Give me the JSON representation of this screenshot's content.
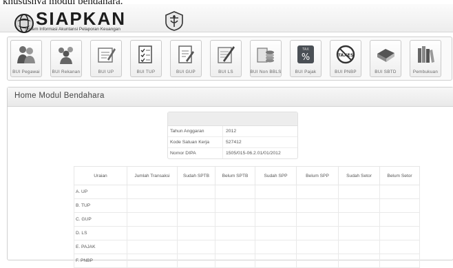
{
  "page_caption": "khususnya modul bendahara.",
  "app": {
    "title": "SIAPKAN",
    "subtitle": "Sistem Informasi Akuntansi Pelaporan Keuangan"
  },
  "toolbar": {
    "buttons": [
      {
        "label": "BUI Pegawai",
        "icon": "people-icon"
      },
      {
        "label": "BUI Rekanan",
        "icon": "group-icon"
      },
      {
        "label": "BUI UP",
        "icon": "document-edit-icon"
      },
      {
        "label": "BUI TUP",
        "icon": "checklist-icon"
      },
      {
        "label": "BUI GUP",
        "icon": "document-pencil-icon"
      },
      {
        "label": "BUI LS",
        "icon": "form-pencil-icon"
      },
      {
        "label": "BUI Non BBLS",
        "icon": "coins-icon"
      },
      {
        "label": "BUI Pajak",
        "icon": "tax-percent-icon"
      },
      {
        "label": "BUI PNBP",
        "icon": "no-taxes-icon"
      },
      {
        "label": "BUI SBTD",
        "icon": "book-icon"
      },
      {
        "label": "Pembukuan",
        "icon": "books-icon"
      }
    ]
  },
  "panel": {
    "title": "Home Modul Bendahara"
  },
  "info": {
    "rows": [
      {
        "label": "Tahun Anggaran",
        "value": "2012"
      },
      {
        "label": "Kode Satuan Kerja",
        "value": "527412"
      },
      {
        "label": "Nomor DIPA",
        "value": "1505/015-06.2.01/01/2012"
      }
    ]
  },
  "table": {
    "headers": [
      "Uraian",
      "Jumlah Transaksi",
      "Sudah SPTB",
      "Belum SPTB",
      "Sudah SPP",
      "Belum SPP",
      "Sudah Setor",
      "Belum Setor"
    ],
    "rows": [
      "A. UP",
      "B. TUP",
      "C. GUP",
      "D. LS",
      "E. PAJAK",
      "F. PNBP"
    ]
  },
  "colors": {
    "toolbar_bg": "#fafafa",
    "header_bg": "#ededed",
    "tax_icon_bg": "#4a4f55"
  }
}
